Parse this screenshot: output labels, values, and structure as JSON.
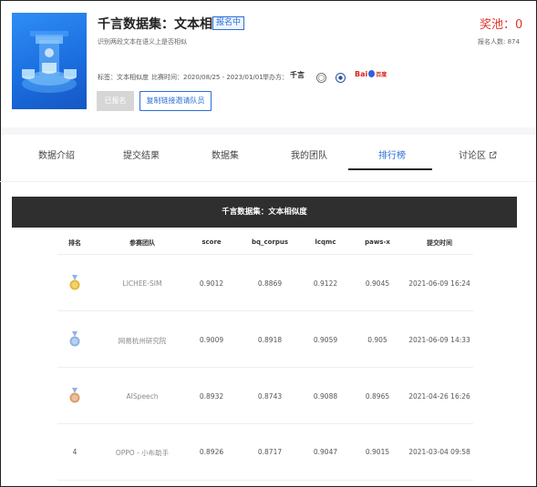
{
  "header": {
    "title": "千言数据集：文本相似度",
    "status_badge": "报名中",
    "description": "识别两段文本在语义上是否相似",
    "prize_label": "奖池：0",
    "signup_count": "报名人数: 874",
    "tags_label": "标签：",
    "tags_value": "文本相似度",
    "period_label": "比赛时间：",
    "period_value": "2020/08/25 - 2023/01/01",
    "organizer_label": "举办方：",
    "organizer_logo_text": "千言",
    "baidu_logo_text": "Bai",
    "baidu_logo_suffix": "百度",
    "joined_button": "已报名",
    "invite_button": "复制链接邀请队员"
  },
  "tabs": [
    {
      "label": "数据介绍"
    },
    {
      "label": "提交结果"
    },
    {
      "label": "数据集"
    },
    {
      "label": "我的团队"
    },
    {
      "label": "排行榜"
    },
    {
      "label": "讨论区"
    }
  ],
  "active_tab": "排行榜",
  "leaderboard": {
    "title": "千言数据集：文本相似度",
    "columns": [
      "排名",
      "参赛团队",
      "score",
      "bq_corpus",
      "lcqmc",
      "paws-x",
      "提交时间"
    ],
    "rows": [
      {
        "rank": "",
        "medal": "gold",
        "team": "LICHEE-SIM",
        "score": "0.9012",
        "bq_corpus": "0.8869",
        "lcqmc": "0.9122",
        "paws_x": "0.9045",
        "time": "2021-06-09 16:24"
      },
      {
        "rank": "",
        "medal": "silver",
        "team": "网易杭州研究院",
        "score": "0.9009",
        "bq_corpus": "0.8918",
        "lcqmc": "0.9059",
        "paws_x": "0.905",
        "time": "2021-06-09 14:33"
      },
      {
        "rank": "",
        "medal": "bronze",
        "team": "AISpeech",
        "score": "0.8932",
        "bq_corpus": "0.8743",
        "lcqmc": "0.9088",
        "paws_x": "0.8965",
        "time": "2021-04-26 16:26"
      },
      {
        "rank": "4",
        "medal": "",
        "team": "OPPO - 小布助手",
        "score": "0.8926",
        "bq_corpus": "0.8717",
        "lcqmc": "0.9047",
        "paws_x": "0.9015",
        "time": "2021-03-04 09:58"
      }
    ]
  },
  "colors": {
    "accent": "#2a6fd6",
    "prize": "#e0352b",
    "banner": "#2f2f2f",
    "gold": "#e6b93a",
    "silver": "#8fb3e3",
    "bronze": "#d9a070"
  },
  "icons": {
    "external_link": "external-link-icon",
    "cover": "server-stack-illustration"
  }
}
